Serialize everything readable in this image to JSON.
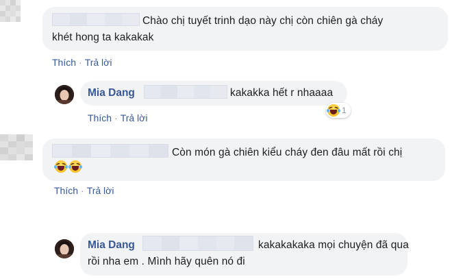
{
  "comments": [
    {
      "author": "",
      "line1": "Chào chị tuyết trinh dạo này chị còn chiên gà cháy",
      "line2": "khét hong ta kakakak",
      "actions": {
        "like": "Thích",
        "reply": "Trả lời",
        "separator": "·"
      }
    },
    {
      "author": "Mia Dang",
      "line1": "kakakka hết r nhaaaa",
      "actions": {
        "like": "Thích",
        "reply": "Trả lời",
        "separator": "·"
      },
      "reaction": {
        "icon": "laugh-cry-emoji",
        "count": "1"
      }
    },
    {
      "author": "",
      "line1": "Còn món gà chiên kiểu cháy đen đâu mất rồi chị",
      "emojis": [
        "laugh-cry-emoji",
        "laugh-cry-emoji"
      ],
      "actions": {
        "like": "Thích",
        "reply": "Trả lời",
        "separator": "·"
      }
    },
    {
      "author": "Mia Dang",
      "line1": "kakakakaka mọi chuyện đã qua",
      "line2": "rồi nha em . Mình hãy quên nó đi"
    }
  ],
  "colors": {
    "bubble": "#f2f3f5",
    "link": "#385898",
    "meta": "#90949c",
    "text": "#1c1e21"
  }
}
